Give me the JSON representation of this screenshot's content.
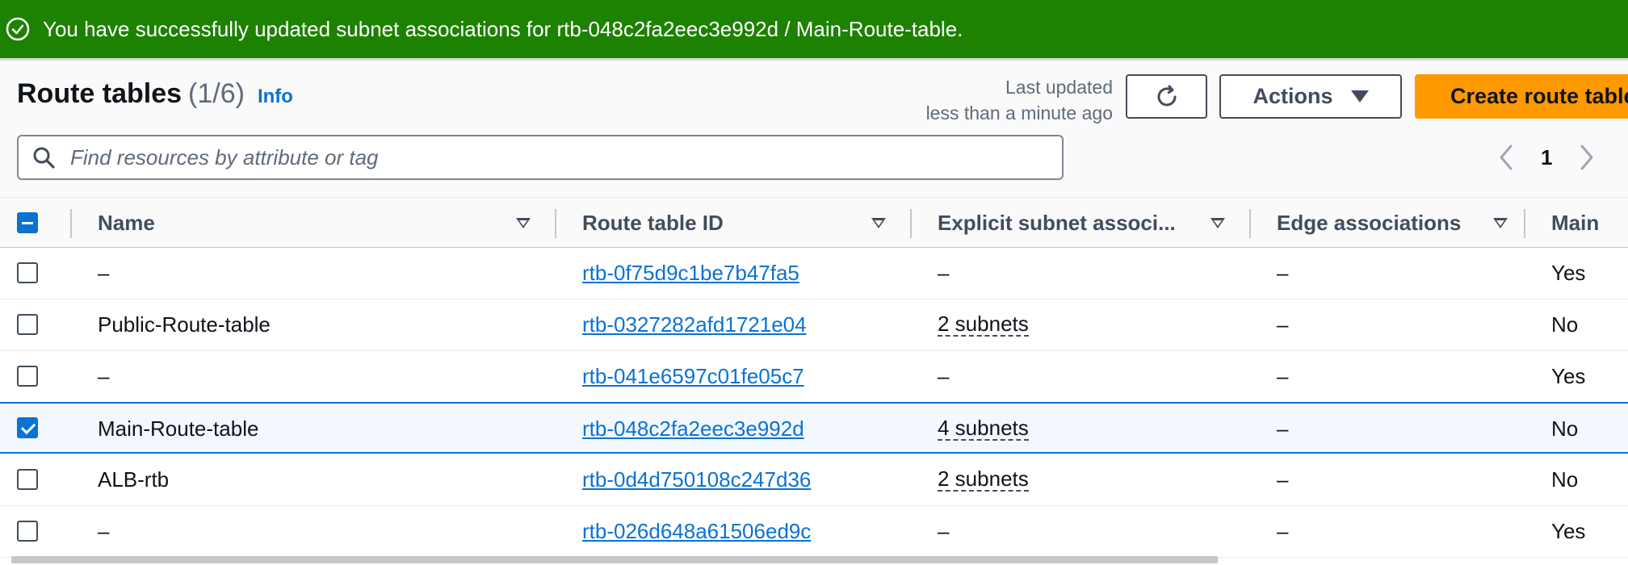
{
  "flash": {
    "message": "You have successfully updated subnet associations for rtb-048c2fa2eec3e992d / Main-Route-table."
  },
  "header": {
    "title": "Route tables",
    "count": "(1/6)",
    "info": "Info",
    "last_updated_line1": "Last updated",
    "last_updated_line2": "less than a minute ago",
    "actions_label": "Actions",
    "create_label": "Create route table"
  },
  "search": {
    "placeholder": "Find resources by attribute or tag"
  },
  "pagination": {
    "current_page": "1"
  },
  "table": {
    "columns": [
      "Name",
      "Route table ID",
      "Explicit subnet associ...",
      "Edge associations",
      "Main"
    ],
    "rows": [
      {
        "name": "–",
        "id": "rtb-0f75d9c1be7b47fa5",
        "subnets": "–",
        "edge": "–",
        "main": "Yes",
        "selected": false
      },
      {
        "name": "Public-Route-table",
        "id": "rtb-0327282afd1721e04",
        "subnets": "2 subnets",
        "edge": "–",
        "main": "No",
        "selected": false
      },
      {
        "name": "–",
        "id": "rtb-041e6597c01fe05c7",
        "subnets": "–",
        "edge": "–",
        "main": "Yes",
        "selected": false
      },
      {
        "name": "Main-Route-table",
        "id": "rtb-048c2fa2eec3e992d",
        "subnets": "4 subnets",
        "edge": "–",
        "main": "No",
        "selected": true
      },
      {
        "name": "ALB-rtb",
        "id": "rtb-0d4d750108c247d36",
        "subnets": "2 subnets",
        "edge": "–",
        "main": "No",
        "selected": false
      },
      {
        "name": "–",
        "id": "rtb-026d648a61506ed9c",
        "subnets": "–",
        "edge": "–",
        "main": "Yes",
        "selected": false
      }
    ]
  },
  "colors": {
    "success": "#1d8102",
    "primary_button": "#ff9900",
    "link": "#0972d3"
  }
}
